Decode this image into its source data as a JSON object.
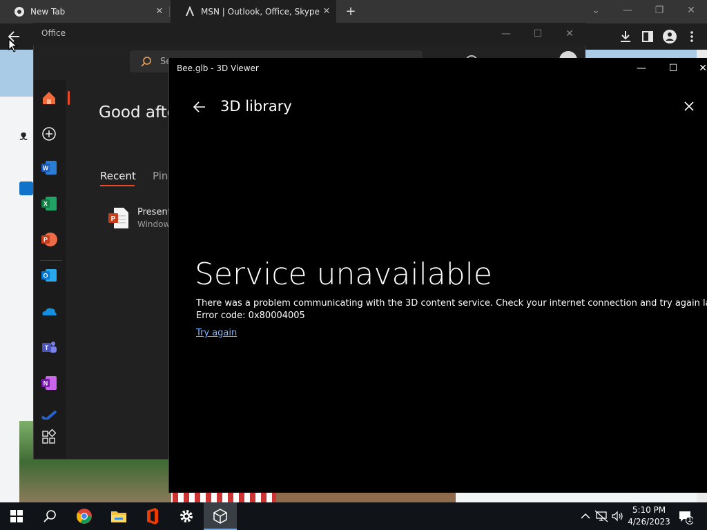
{
  "browser": {
    "tabs": [
      {
        "title": "New Tab",
        "favicon": "chrome-icon"
      },
      {
        "title": "MSN | Outlook, Office, Skype, Bing",
        "favicon": "msn-icon"
      }
    ],
    "new_tab_label": "+"
  },
  "office": {
    "window_title": "Office",
    "search_placeholder": "Se",
    "greeting": "Good afte",
    "tabs": {
      "recent": "Recent",
      "pinned": "Pin"
    },
    "recent_file": {
      "name": "Present",
      "location": "Window"
    },
    "rail_icons": [
      "home-icon",
      "add-icon",
      "word-icon",
      "excel-icon",
      "powerpoint-icon",
      "outlook-icon",
      "onedrive-icon",
      "teams-icon",
      "onenote-icon",
      "to-do-icon",
      "apps-icon"
    ]
  },
  "viewer": {
    "window_title": "Bee.glb - 3D Viewer",
    "library_title": "3D library",
    "error_title": "Service unavailable",
    "error_message": "There was a problem communicating with the 3D content service. Check your internet connection and try again later.",
    "error_code": "Error code: 0x80004005",
    "retry_link": "Try again"
  },
  "taskbar": {
    "apps": [
      "start-icon",
      "search-icon",
      "chrome-icon",
      "file-explorer-icon",
      "office-icon",
      "settings-icon",
      "3d-viewer-icon"
    ],
    "time": "5:10 PM",
    "date": "4/26/2023",
    "notification_count": "1"
  },
  "colors": {
    "office_accent": "#e74a25",
    "link": "#7cb3ff",
    "taskbar": "#101418"
  }
}
